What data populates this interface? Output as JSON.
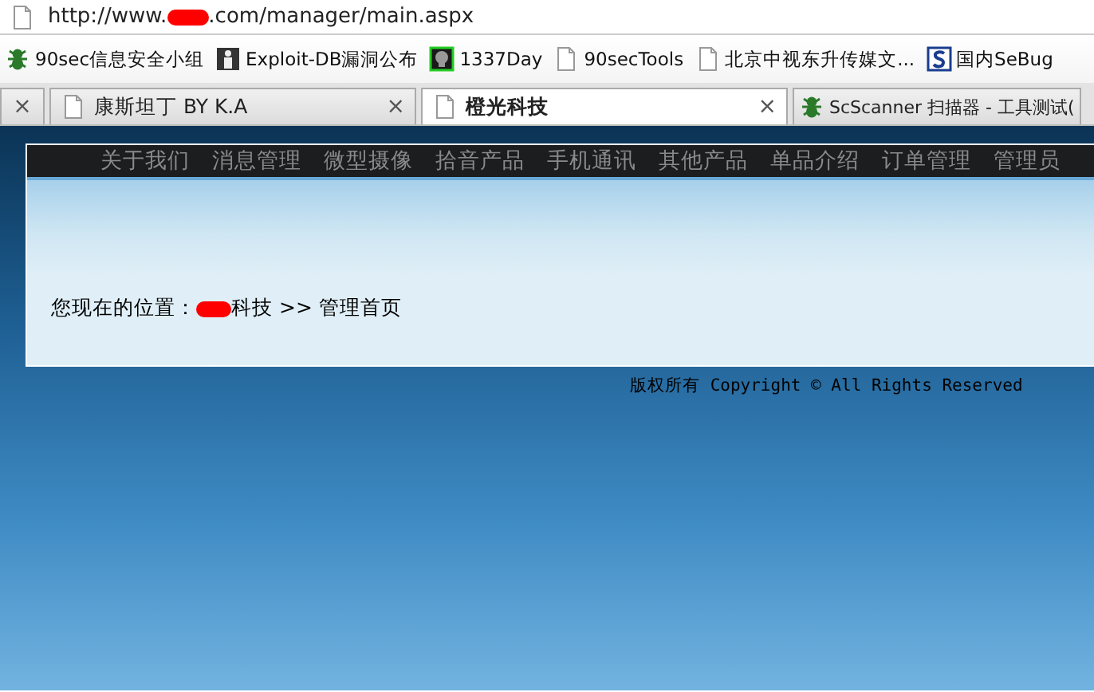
{
  "address_bar": {
    "url_start": "http://www.",
    "redacted": true,
    "url_end": ".com/manager/main.aspx"
  },
  "bookmarks": [
    {
      "label": "90sec信息安全小组",
      "kind": "bug"
    },
    {
      "label": "Exploit-DB漏洞公布",
      "kind": "person"
    },
    {
      "label": "1337Day",
      "kind": "skull"
    },
    {
      "label": "90secTools",
      "kind": "page"
    },
    {
      "label": "北京中视东升传媒文...",
      "kind": "page"
    },
    {
      "label": "国内SeBug",
      "kind": "s"
    }
  ],
  "tabs": [
    {
      "close": "×",
      "selected": false,
      "kind": "plain"
    },
    {
      "label": "康斯坦丁 BY K.A",
      "close": "×",
      "selected": false,
      "kind": "page"
    },
    {
      "label": "橙光科技",
      "close": "×",
      "selected": true,
      "kind": "page"
    },
    {
      "label": "ScScanner 扫描器 - 工具测试(",
      "selected": false,
      "kind": "bug"
    }
  ],
  "nav_menu": [
    "关于我们",
    "消息管理",
    "微型摄像",
    "拾音产品",
    "手机通讯",
    "其他产品",
    "单品介绍",
    "订单管理",
    "管理员"
  ],
  "breadcrumb": {
    "prefix": "您现在的位置：",
    "redacted": true,
    "path": "科技 >> 管理首页"
  },
  "footer": "版权所有 Copyright © All Rights Reserved"
}
